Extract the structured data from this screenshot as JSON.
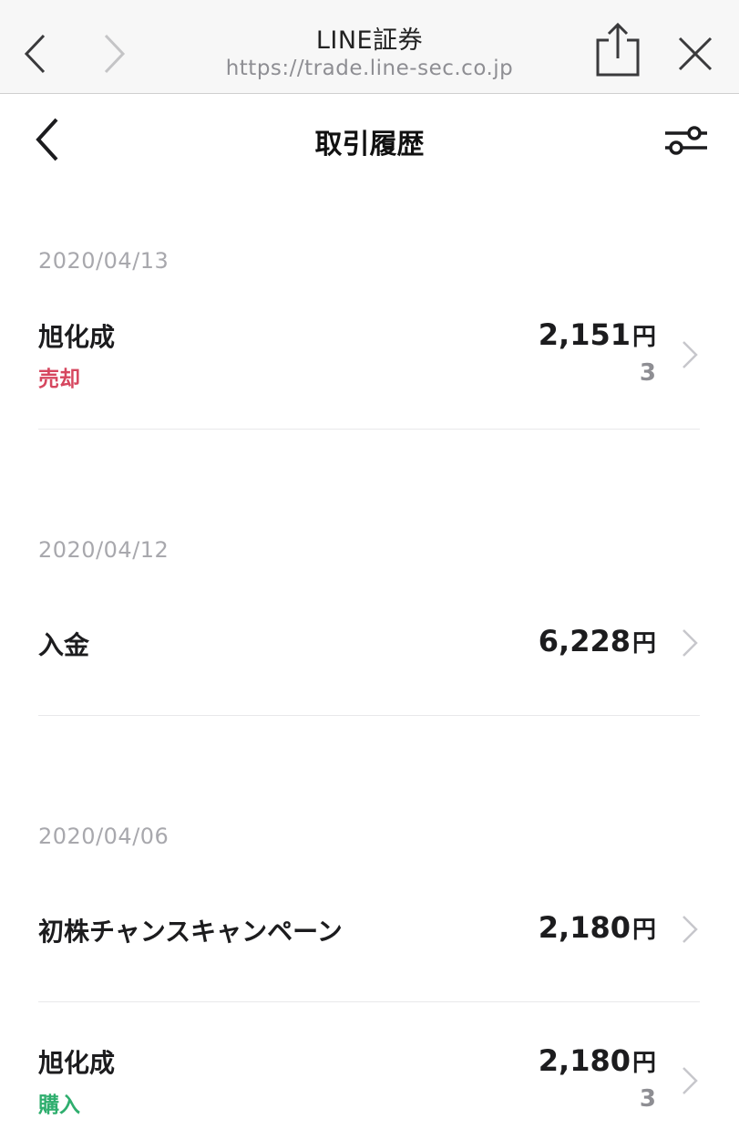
{
  "browser": {
    "title": "LINE証券",
    "url": "https://trade.line-sec.co.jp"
  },
  "header": {
    "title": "取引履歴"
  },
  "groups": [
    {
      "date": "2020/04/13",
      "items": [
        {
          "name": "旭化成",
          "type": "売却",
          "type_color": "#d6475f",
          "amount": "2,151",
          "unit": "円",
          "quantity": "3"
        }
      ]
    },
    {
      "date": "2020/04/12",
      "items": [
        {
          "name": "入金",
          "amount": "6,228",
          "unit": "円"
        }
      ]
    },
    {
      "date": "2020/04/06",
      "items": [
        {
          "name": "初株チャンスキャンペーン",
          "amount": "2,180",
          "unit": "円"
        },
        {
          "name": "旭化成",
          "type": "購入",
          "type_color": "#2fae6e",
          "amount": "2,180",
          "unit": "円",
          "quantity": "3"
        }
      ]
    }
  ],
  "icons": {
    "back": "chevron-left-icon",
    "forward": "chevron-right-icon",
    "share": "share-icon",
    "close": "close-icon",
    "filter": "sliders-icon",
    "row_chevron": "chevron-right-icon"
  },
  "colors": {
    "sell": "#d6475f",
    "buy": "#2fae6e",
    "date": "#a8a8ad"
  }
}
